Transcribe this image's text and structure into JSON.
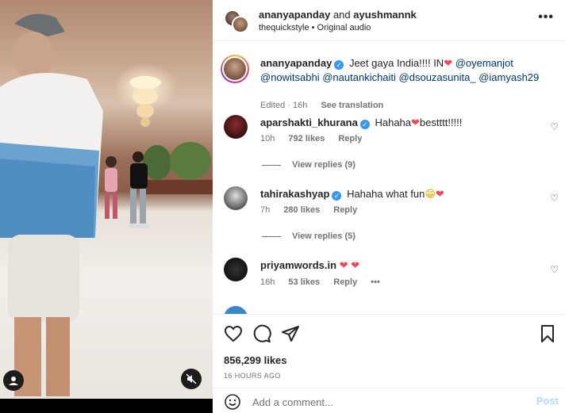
{
  "header": {
    "user1": "ananyapanday",
    "connector": "and",
    "user2": "ayushmannk",
    "subtitle": "thequickstyle • Original audio",
    "more_icon": "more-horizontal-icon"
  },
  "caption": {
    "username": "ananyapanday",
    "text": "Jeet gaya India!!!! IN",
    "mentions_line1": "@oyemanjot",
    "mentions_line2": "@nowitsabhi @nautankichaiti @dsouzasunita_ @iamyash29",
    "edited": "Edited",
    "time": "16h",
    "see_translation": "See translation"
  },
  "comments": [
    {
      "username": "aparshakti_khurana",
      "verified": true,
      "text_before": "Hahaha",
      "text_after": "bestttt!!!!!",
      "time": "10h",
      "likes": "792 likes",
      "reply": "Reply",
      "view_replies": "View replies (9)"
    },
    {
      "username": "tahirakashyap",
      "verified": true,
      "text_before": "Hahaha what fun",
      "text_after": "",
      "time": "7h",
      "likes": "280 likes",
      "reply": "Reply",
      "view_replies": "View replies (5)"
    },
    {
      "username": "priyamwords.in",
      "verified": false,
      "time": "16h",
      "likes": "53 likes",
      "reply": "Reply",
      "more": "•••"
    }
  ],
  "footer": {
    "likes": "856,299 likes",
    "time_ago": "16 HOURS AGO",
    "comment_placeholder": "Add a comment...",
    "post_label": "Post"
  },
  "colors": {
    "link": "#00376b",
    "verified": "#3897f0",
    "heart": "#ed4956",
    "post_disabled": "#b3dbff"
  }
}
